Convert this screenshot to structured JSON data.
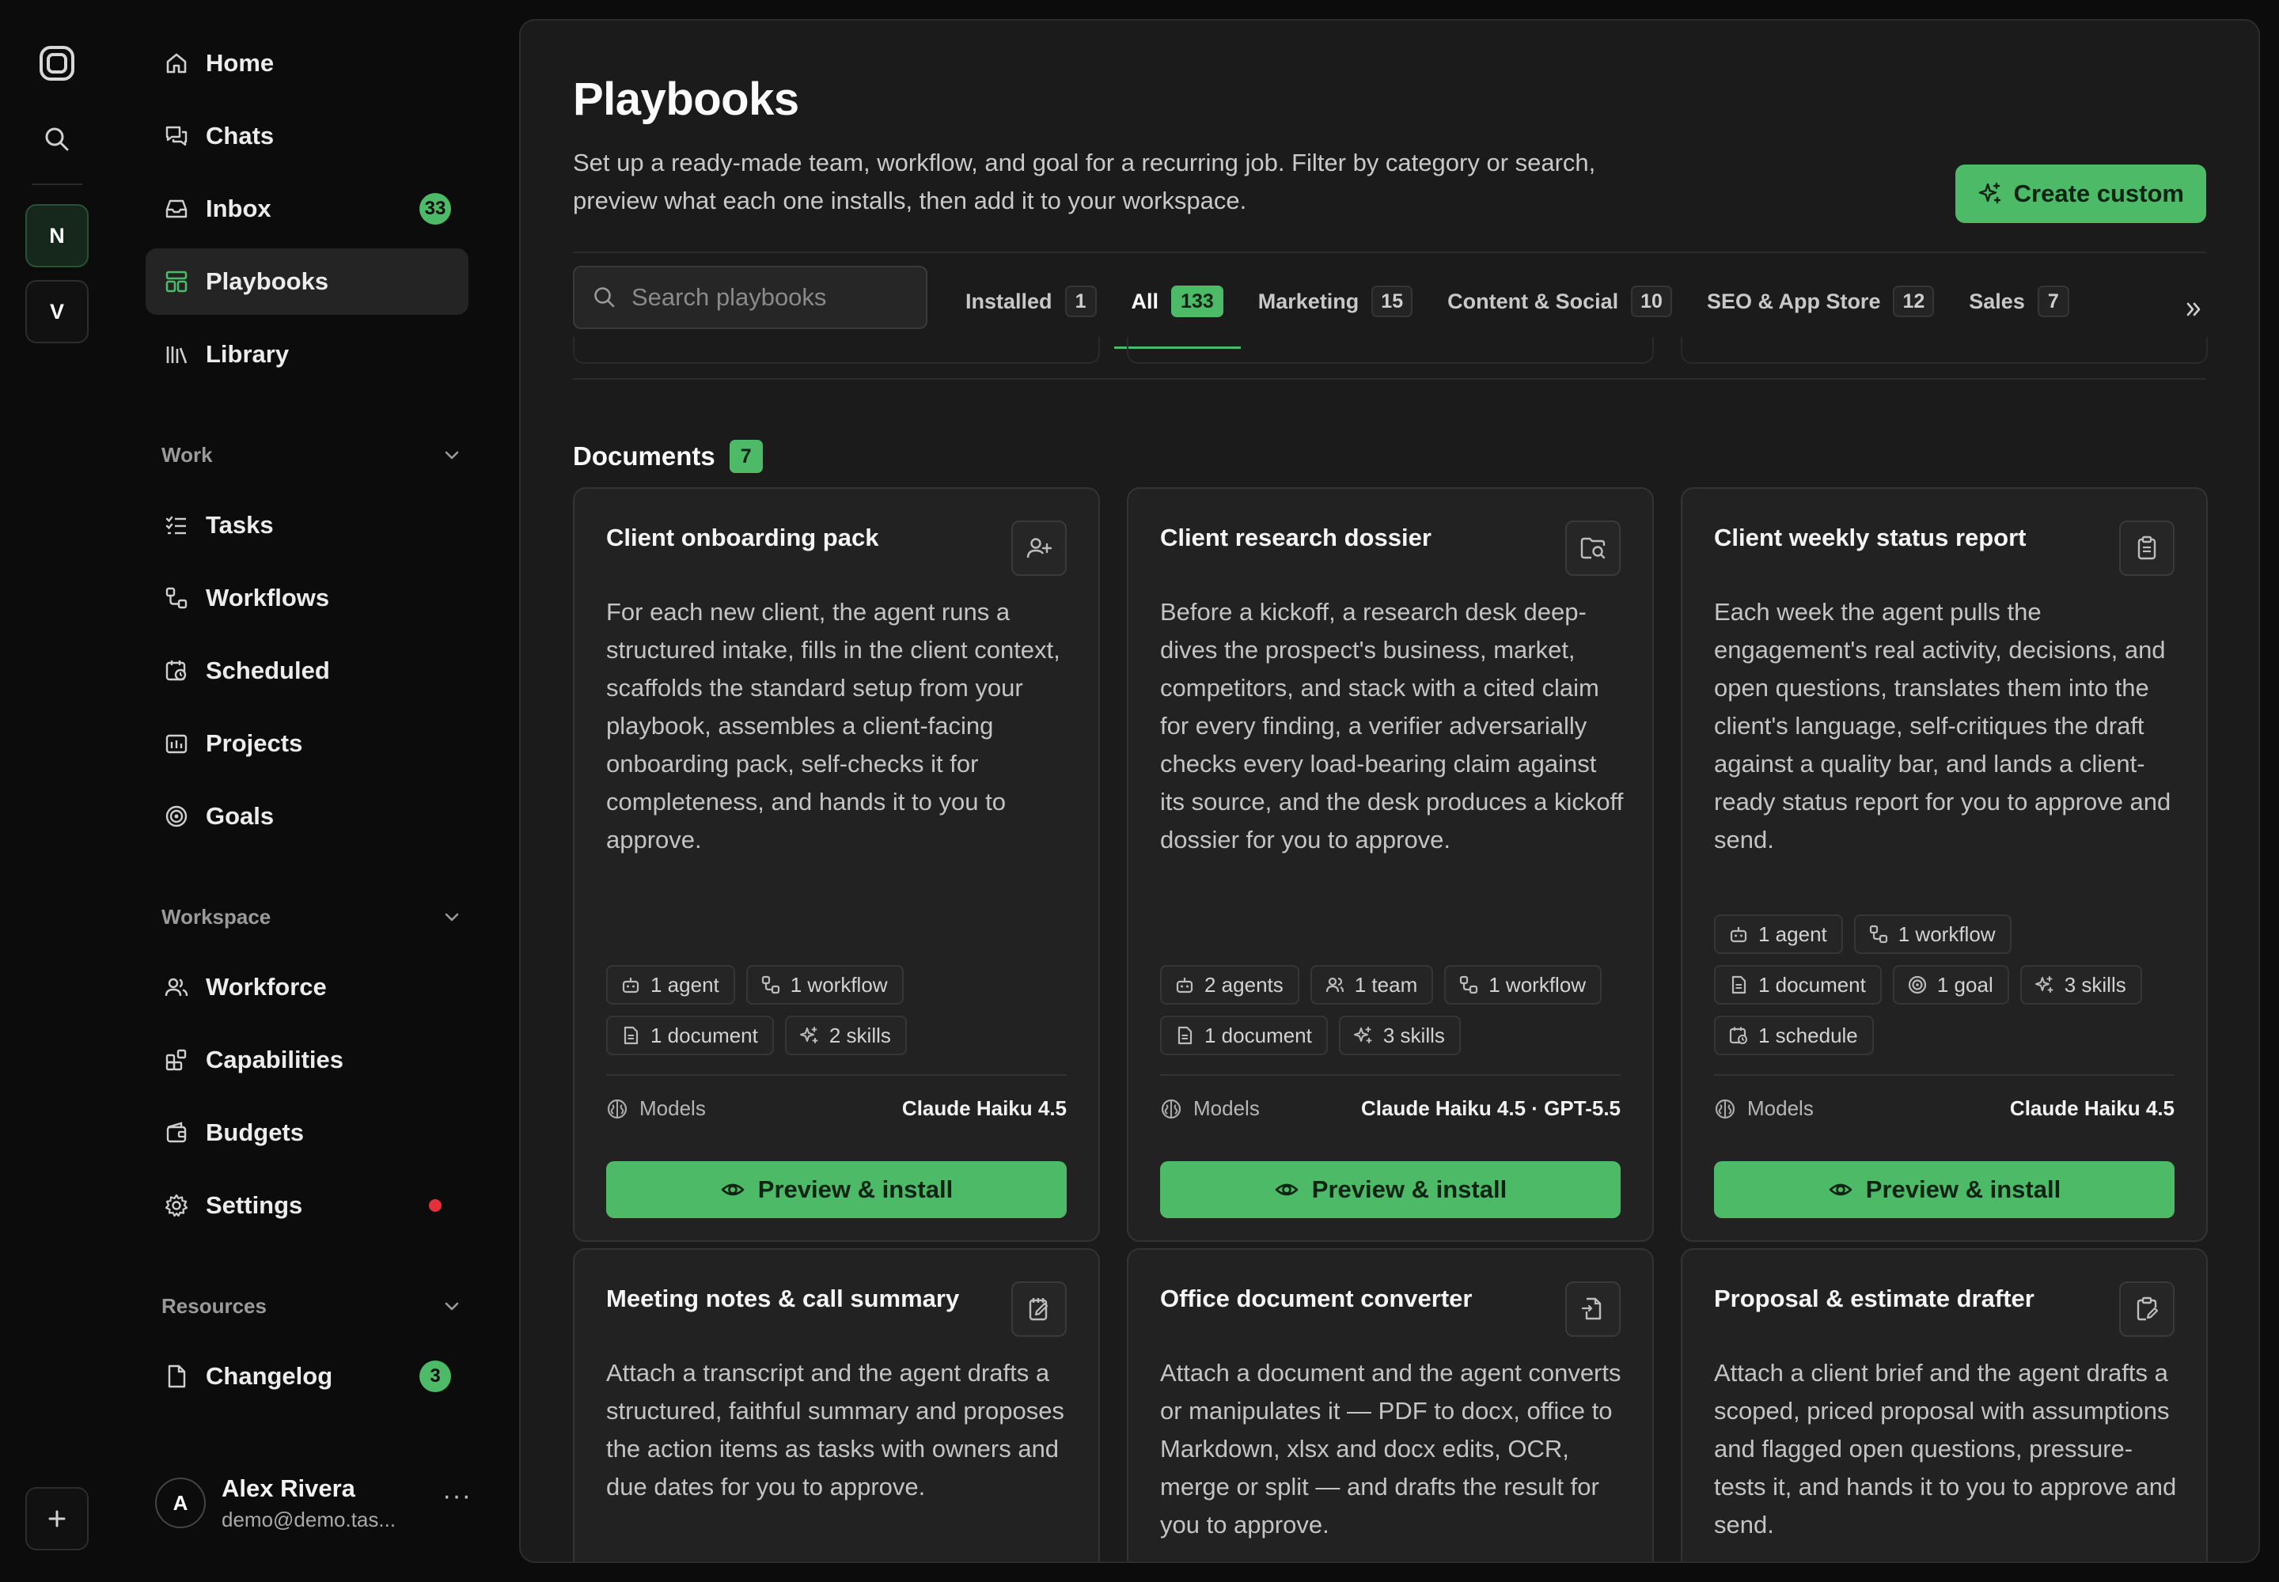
{
  "sidebar": {
    "workspaces": [
      "N",
      "V"
    ],
    "nav": [
      {
        "label": "Home"
      },
      {
        "label": "Chats"
      },
      {
        "label": "Inbox",
        "badge": "33"
      },
      {
        "label": "Playbooks"
      },
      {
        "label": "Library"
      }
    ],
    "sections": {
      "work": {
        "label": "Work",
        "items": [
          {
            "label": "Tasks"
          },
          {
            "label": "Workflows"
          },
          {
            "label": "Scheduled"
          },
          {
            "label": "Projects"
          },
          {
            "label": "Goals"
          }
        ]
      },
      "workspace": {
        "label": "Workspace",
        "items": [
          {
            "label": "Workforce"
          },
          {
            "label": "Capabilities"
          },
          {
            "label": "Budgets"
          },
          {
            "label": "Settings"
          }
        ]
      },
      "resources": {
        "label": "Resources",
        "items": [
          {
            "label": "Changelog",
            "badge": "3"
          }
        ]
      }
    },
    "user": {
      "initial": "A",
      "name": "Alex Rivera",
      "email": "demo@demo.tas..."
    }
  },
  "main": {
    "title": "Playbooks",
    "subtitle": "Set up a ready-made team, workflow, and goal for a recurring job. Filter by category or search, preview what each one installs, then add it to your workspace.",
    "create_label": "Create custom",
    "search_placeholder": "Search playbooks",
    "tabs": [
      {
        "label": "Installed",
        "count": "1"
      },
      {
        "label": "All",
        "count": "133"
      },
      {
        "label": "Marketing",
        "count": "15"
      },
      {
        "label": "Content & Social",
        "count": "10"
      },
      {
        "label": "SEO & App Store",
        "count": "12"
      },
      {
        "label": "Sales",
        "count": "7"
      }
    ],
    "section": {
      "title": "Documents",
      "count": "7"
    },
    "models_label": "Models",
    "preview_label": "Preview & install",
    "cards": [
      {
        "title": "Client onboarding pack",
        "icon": "user-plus-icon",
        "description": "For each new client, the agent runs a structured intake, fills in the client context, scaffolds the standard setup from your playbook, assembles a client-facing onboarding pack, self-checks it for completeness, and hands it to you to approve.",
        "chips": [
          {
            "icon": "agent",
            "label": "1 agent"
          },
          {
            "icon": "workflow",
            "label": "1 workflow"
          },
          {
            "icon": "document",
            "label": "1 document"
          },
          {
            "icon": "skills",
            "label": "2 skills"
          }
        ],
        "models": "Claude Haiku 4.5"
      },
      {
        "title": "Client research dossier",
        "icon": "folder-search-icon",
        "description": "Before a kickoff, a research desk deep-dives the prospect's business, market, competitors, and stack with a cited claim for every finding, a verifier adversarially checks every load-bearing claim against its source, and the desk produces a kickoff dossier for you to approve.",
        "chips": [
          {
            "icon": "agent",
            "label": "2 agents"
          },
          {
            "icon": "team",
            "label": "1 team"
          },
          {
            "icon": "workflow",
            "label": "1 workflow"
          },
          {
            "icon": "document",
            "label": "1 document"
          },
          {
            "icon": "skills",
            "label": "3 skills"
          }
        ],
        "models": "Claude Haiku 4.5 · GPT-5.5"
      },
      {
        "title": "Client weekly status report",
        "icon": "clipboard-icon",
        "description": "Each week the agent pulls the engagement's real activity, decisions, and open questions, translates them into the client's language, self-critiques the draft against a quality bar, and lands a client-ready status report for you to approve and send.",
        "chips": [
          {
            "icon": "agent",
            "label": "1 agent"
          },
          {
            "icon": "workflow",
            "label": "1 workflow"
          },
          {
            "icon": "document",
            "label": "1 document"
          },
          {
            "icon": "goal",
            "label": "1 goal"
          },
          {
            "icon": "skills",
            "label": "3 skills"
          },
          {
            "icon": "schedule",
            "label": "1 schedule"
          }
        ],
        "models": "Claude Haiku 4.5"
      },
      {
        "title": "Meeting notes & call summary",
        "icon": "notes-edit-icon",
        "description": "Attach a transcript and the agent drafts a structured, faithful summary and proposes the action items as tasks with owners and due dates for you to approve."
      },
      {
        "title": "Office document converter",
        "icon": "file-convert-icon",
        "description": "Attach a document and the agent converts or manipulates it — PDF to docx, office to Markdown, xlsx and docx edits, OCR, merge or split — and drafts the result for you to approve."
      },
      {
        "title": "Proposal & estimate drafter",
        "icon": "clipboard-edit-icon",
        "description": "Attach a client brief and the agent drafts a scoped, priced proposal with assumptions and flagged open questions, pressure-tests it, and hands it to you to approve and send."
      }
    ]
  },
  "colors": {
    "accent": "#4cba67",
    "panel": "#1b1b1b",
    "card": "#222222",
    "alert": "#e5303a"
  }
}
